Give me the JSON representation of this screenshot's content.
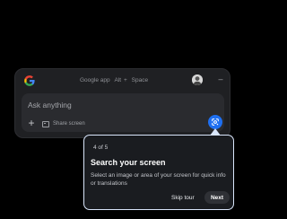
{
  "window": {
    "app_name": "Google app",
    "shortcut_key1": "Alt",
    "shortcut_sep": "+",
    "shortcut_key2": "Space",
    "minimize_glyph": "–"
  },
  "search": {
    "placeholder": "Ask anything",
    "add_glyph": "+",
    "share_label": "Share screen"
  },
  "tour": {
    "step": "4 of 5",
    "title": "Search your screen",
    "body": "Select an image or area of your screen for quick info or translations",
    "skip_label": "Skip tour",
    "next_label": "Next"
  },
  "icons": {
    "logo": "google-g-icon",
    "avatar": "profile-avatar",
    "minimize": "minimize-icon",
    "add": "plus-icon",
    "share": "share-screen-icon",
    "lens": "google-lens-icon"
  },
  "colors": {
    "background": "#000000",
    "window": "#1f2023",
    "input": "#2a2b2f",
    "accent": "#1e6ff0",
    "tooltip_border": "#d9e6fb"
  }
}
